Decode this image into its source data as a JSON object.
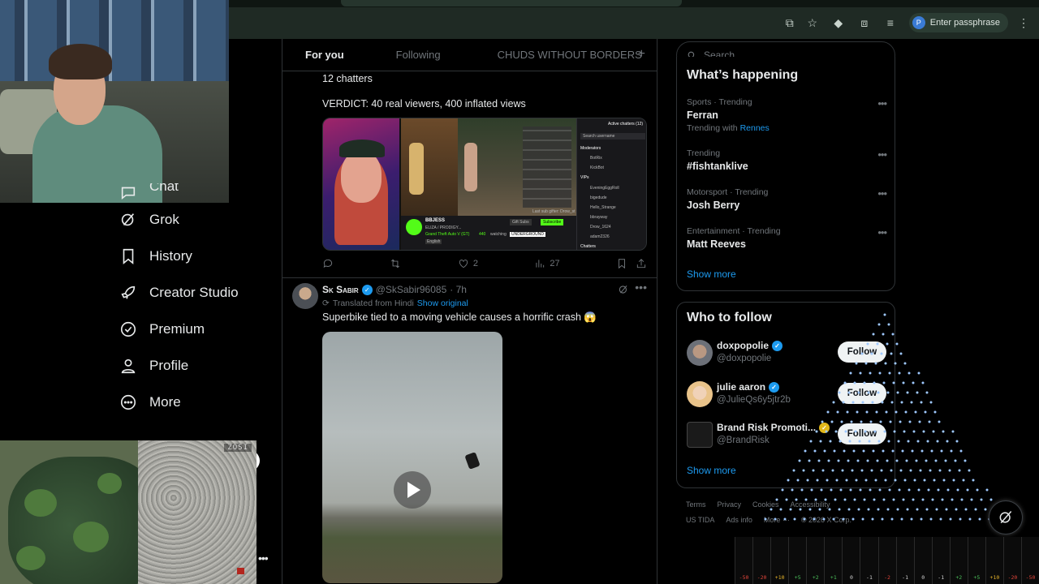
{
  "browser": {
    "passphrase_label": "Enter passphrase",
    "passphrase_avatar": "P",
    "toolbar_icons": [
      "install-icon",
      "star-icon",
      "extension-shield-icon",
      "puzzle-icon",
      "reading-list-icon",
      "kebab-menu-icon"
    ]
  },
  "camera2": {
    "label": "ZOSI"
  },
  "nav": {
    "partial_label": "Chat",
    "items": [
      {
        "label": "Grok",
        "icon": "grok-icon"
      },
      {
        "label": "History",
        "icon": "bookmark-icon"
      },
      {
        "label": "Creator Studio",
        "icon": "rocket-icon"
      },
      {
        "label": "Premium",
        "icon": "verified-badge-icon"
      },
      {
        "label": "Profile",
        "icon": "person-icon"
      },
      {
        "label": "More",
        "icon": "more-circle-icon"
      }
    ],
    "more_dots": "•••"
  },
  "timeline": {
    "tabs": [
      {
        "label": "For you",
        "active": true
      },
      {
        "label": "Following",
        "active": false
      },
      {
        "label": "CHUDS WITHOUT BORDERS",
        "active": false
      }
    ],
    "add_tab": "+",
    "post1": {
      "line1": "12 chatters",
      "line2": "VERDICT: 40 real viewers, 400 inflated views",
      "media": {
        "active_chatters": "Active chatters (12)",
        "search_placeholder": "Search username",
        "moderators_heading": "Moderators",
        "moderators": [
          "BotRix",
          "KickBot"
        ],
        "vips_heading": "VIPs",
        "vips": [
          "EveningEggRoll",
          "bigedude",
          "Hello_Strange",
          "bbrayway",
          "Drow_1624",
          "adam2326"
        ],
        "chatters_heading": "Chatters",
        "streamer": "BBJESS",
        "stream_title": "ELIZA / PRODIGY...",
        "game": "Grand Theft Auto V (GT)",
        "language": "English",
        "watching": "440",
        "watching_label": "watching",
        "gift_subs": "Gift Subs",
        "subscribe": "Subscribe",
        "last_sub": "Last sub gifter: Drow_st",
        "sticker": "UNDERGROUND"
      },
      "actions": {
        "reply": "",
        "repost": "",
        "likes": "2",
        "views": "27"
      }
    },
    "post2": {
      "name": "Sk Sabir",
      "handle": "@SkSabir96085",
      "time": "· 7h",
      "more": "•••",
      "translated": "Translated from Hindi",
      "show_original": "Show original",
      "text": "Superbike tied to a moving vehicle causes a horrific crash 😱"
    }
  },
  "sidebar": {
    "search_placeholder": "Search",
    "trends_title": "What’s happening",
    "trends": [
      {
        "meta": "Sports · Trending",
        "name": "Ferran",
        "with_label": "Trending with",
        "with": "Rennes"
      },
      {
        "meta": "Trending",
        "name": "#fishtanklive"
      },
      {
        "meta": "Motorsport · Trending",
        "name": "Josh Berry"
      },
      {
        "meta": "Entertainment · Trending",
        "name": "Matt Reeves"
      }
    ],
    "trend_more": "•••",
    "trends_show_more": "Show more",
    "wtf_title": "Who to follow",
    "who_to_follow": [
      {
        "name": "doxpopolie",
        "handle": "@doxpopolie",
        "badge": "blue",
        "button": "Follow"
      },
      {
        "name": "julie aaron",
        "handle": "@JulieQs6y5jtr2b",
        "badge": "blue",
        "button": "Follow"
      },
      {
        "name": "Brand Risk Promoti...",
        "handle": "@BrandRisk",
        "badge": "gold",
        "button": "Follow"
      }
    ],
    "wtf_show_more": "Show more",
    "footer_row1": [
      "Terms",
      "Privacy",
      "Cookies",
      "Accessibility"
    ],
    "footer_row2": [
      "US TIDA",
      "Ads info",
      "More ···",
      "© 2026 X Corp."
    ]
  },
  "meter": {
    "labels": [
      "-50",
      "-20",
      "+10",
      "+5",
      "+2",
      "+1",
      "0",
      "-1",
      "-2",
      "-1",
      "0",
      "-1",
      "+2",
      "+5",
      "+10",
      "-20",
      "-50"
    ],
    "colors": [
      "#e0453a",
      "#e0453a",
      "#e5b32a",
      "#4bbf5a",
      "#4bbf5a",
      "#4bbf5a",
      "#cfcfcf",
      "#cfcfcf",
      "#e0453a",
      "#cfcfcf",
      "#cfcfcf",
      "#cfcfcf",
      "#4bbf5a",
      "#4bbf5a",
      "#e5b32a",
      "#e0453a",
      "#e0453a"
    ]
  }
}
